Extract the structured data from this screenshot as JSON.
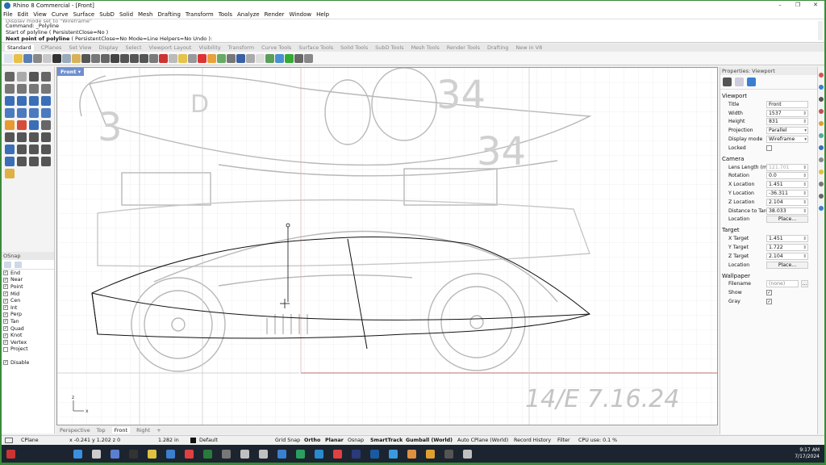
{
  "window": {
    "title": "Rhino 8 Commercial - [Front]",
    "controls": [
      "–",
      "❐",
      "✕"
    ]
  },
  "menu": [
    "File",
    "Edit",
    "View",
    "Curve",
    "Surface",
    "SubD",
    "Solid",
    "Mesh",
    "Drafting",
    "Transform",
    "Tools",
    "Analyze",
    "Render",
    "Window",
    "Help"
  ],
  "command_history": {
    "line0": "Display mode set to \"Wireframe\"",
    "line1": "Command: _Polyline",
    "line2": "Start of polyline ( PersistentClose=No )",
    "prompt_bold": "Next point of polyline",
    "prompt_rest": " ( PersistentClose=No  Mode=Line  Helpers=No  Undo ):"
  },
  "toolbar_tabs": [
    "Standard",
    "CPlanes",
    "Set View",
    "Display",
    "Select",
    "Viewport Layout",
    "Visibility",
    "Transform",
    "Curve Tools",
    "Surface Tools",
    "Solid Tools",
    "SubD Tools",
    "Mesh Tools",
    "Render Tools",
    "Drafting",
    "New in V8"
  ],
  "toolbar_active_tab": "Standard",
  "viewport": {
    "title": "Front",
    "signature_text": "14/E 7.16.24",
    "axis_z": "z",
    "axis_x": "x"
  },
  "view_tabs": [
    "Perspective",
    "Top",
    "Front",
    "Right",
    "+"
  ],
  "osnap": {
    "header": "OSnap",
    "items": [
      {
        "label": "End",
        "checked": true
      },
      {
        "label": "Near",
        "checked": true
      },
      {
        "label": "Point",
        "checked": true
      },
      {
        "label": "Mid",
        "checked": true
      },
      {
        "label": "Cen",
        "checked": true
      },
      {
        "label": "Int",
        "checked": true
      },
      {
        "label": "Perp",
        "checked": true
      },
      {
        "label": "Tan",
        "checked": true
      },
      {
        "label": "Quad",
        "checked": true
      },
      {
        "label": "Knot",
        "checked": true
      },
      {
        "label": "Vertex",
        "checked": true
      },
      {
        "label": "Project",
        "checked": false
      }
    ],
    "disable_label": "Disable",
    "disable_checked": true
  },
  "properties": {
    "header": "Properties: Viewport",
    "viewport_section": "Viewport",
    "title_label": "Title",
    "title_value": "Front",
    "width_label": "Width",
    "width_value": "1537",
    "height_label": "Height",
    "height_value": "831",
    "projection_label": "Projection",
    "projection_value": "Parallel",
    "display_mode_label": "Display mode",
    "display_mode_value": "Wireframe",
    "locked_label": "Locked",
    "camera_section": "Camera",
    "lens_label": "Lens Length (mm)",
    "lens_value": "121.701",
    "rotation_label": "Rotation",
    "rotation_value": "0.0",
    "xloc_label": "X Location",
    "xloc_value": "1.451",
    "yloc_label": "Y Location",
    "yloc_value": "-36.311",
    "zloc_label": "Z Location",
    "zloc_value": "2.104",
    "dist_label": "Distance to Target",
    "dist_value": "38.033",
    "location_label": "Location",
    "place_button": "Place...",
    "target_section": "Target",
    "xtgt_label": "X Target",
    "xtgt_value": "1.451",
    "ytgt_label": "Y Target",
    "ytgt_value": "1.722",
    "ztgt_label": "Z Target",
    "ztgt_value": "2.104",
    "target_location_label": "Location",
    "target_place_button": "Place...",
    "wallpaper_section": "Wallpaper",
    "filename_label": "Filename",
    "filename_value": "(none)",
    "browse_button": "...",
    "show_label": "Show",
    "show_checked": true,
    "gray_label": "Gray",
    "gray_checked": true
  },
  "status": {
    "cplane": "CPlane",
    "coords": "x -0.241  y 1.202  z 0",
    "distance": "1.282 in",
    "layer": "Default",
    "grid_snap": "Grid Snap",
    "ortho": "Ortho",
    "planar": "Planar",
    "osnap": "Osnap",
    "smarttrack": "SmartTrack",
    "gumball": "Gumball (World)",
    "autocplane": "Auto CPlane (World)",
    "record_history": "Record History",
    "filter": "Filter",
    "cpu": "CPU use: 0.1 %"
  },
  "taskbar": {
    "time": "9:17 AM",
    "date": "7/17/2024"
  }
}
